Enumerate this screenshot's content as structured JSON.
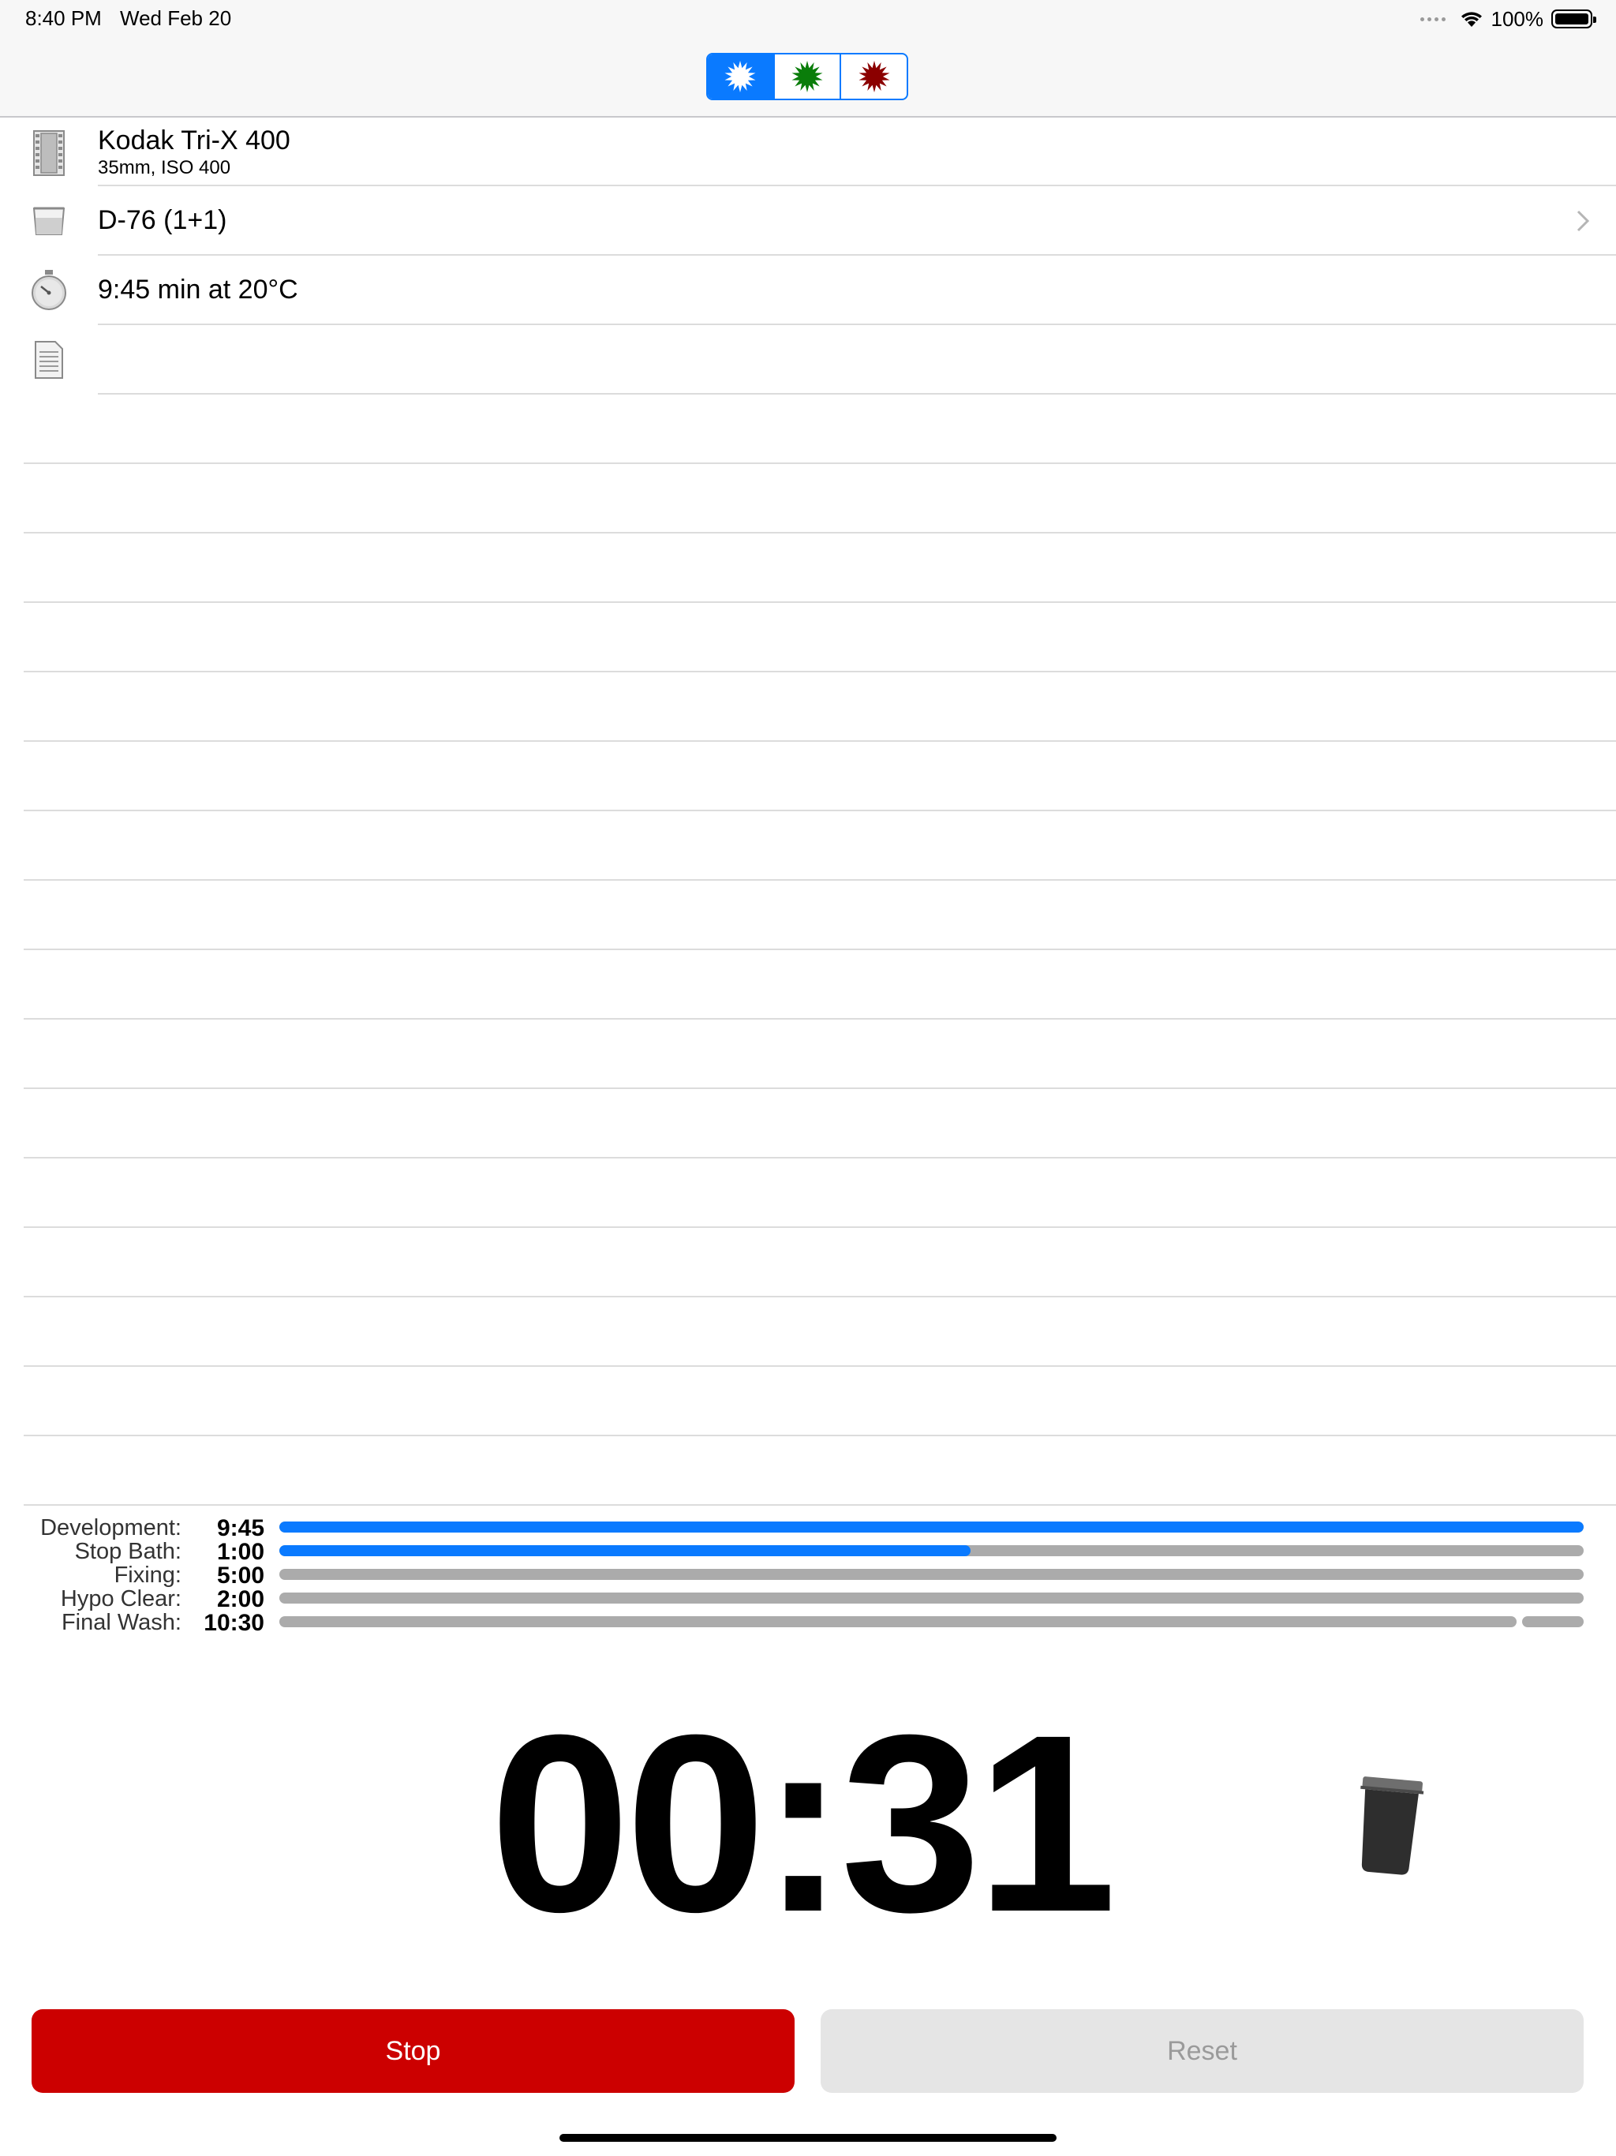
{
  "status_bar": {
    "time": "8:40 PM",
    "date": "Wed Feb 20",
    "battery_text": "100%",
    "wifi_icon": "wifi-icon",
    "battery_icon": "battery-icon"
  },
  "nav": {
    "segments": [
      {
        "icon": "white-burst-icon",
        "color": "#ffffff",
        "selected": true
      },
      {
        "icon": "green-burst-icon",
        "color": "#0a7d0a",
        "selected": false
      },
      {
        "icon": "red-burst-icon",
        "color": "#8b0000",
        "selected": false
      }
    ],
    "accent": "#0a7aff"
  },
  "info": {
    "film": {
      "title": "Kodak Tri-X 400",
      "subtitle": "35mm, ISO 400",
      "icon": "film-strip-icon"
    },
    "developer": {
      "title": "D-76 (1+1)",
      "icon": "beaker-icon"
    },
    "time": {
      "title": "9:45 min at 20°C",
      "icon": "stopwatch-icon"
    },
    "notes": {
      "title": "",
      "icon": "notes-icon"
    }
  },
  "steps": [
    {
      "label": "Development:",
      "time": "9:45",
      "progress": 1.0
    },
    {
      "label": "Stop Bath:",
      "time": "1:00",
      "progress": 0.53
    },
    {
      "label": "Fixing:",
      "time": "5:00",
      "progress": 0.0
    },
    {
      "label": "Hypo Clear:",
      "time": "2:00",
      "progress": 0.0
    },
    {
      "label": "Final Wash:",
      "time": "10:30",
      "progress": 0.0
    }
  ],
  "timer": {
    "display": "00:31",
    "tank_icon": "developing-tank-icon"
  },
  "buttons": {
    "stop_label": "Stop",
    "reset_label": "Reset",
    "stop_color": "#cc0000",
    "reset_color": "#e5e5e5"
  }
}
